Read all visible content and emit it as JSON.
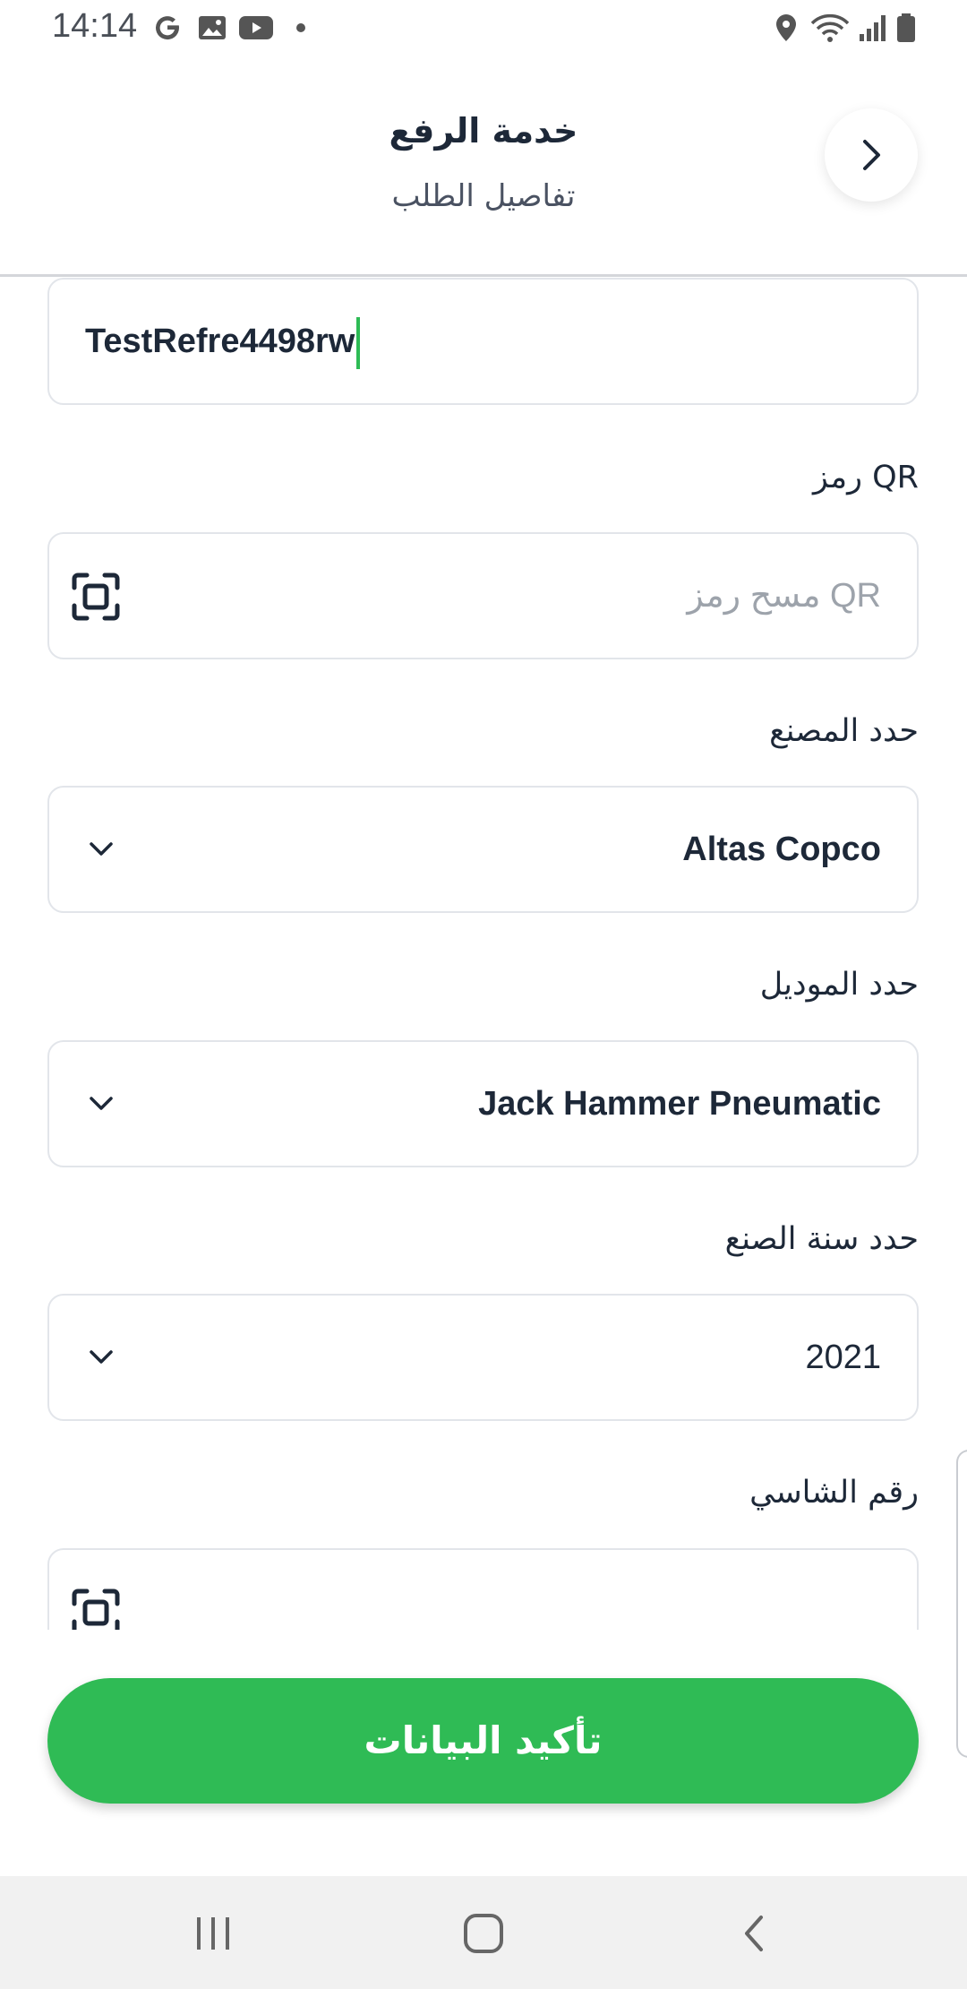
{
  "status_bar": {
    "time": "14:14",
    "icons": [
      "google-icon",
      "image-icon",
      "youtube-icon",
      "dot-icon",
      "location-icon",
      "wifi-icon",
      "signal-icon",
      "battery-icon"
    ]
  },
  "header": {
    "title": "خدمة الرفع",
    "subtitle": "تفاصيل الطلب",
    "back_icon": "chevron-right-icon"
  },
  "form": {
    "reference_field": {
      "value": "TestRefre4498rw"
    },
    "qr": {
      "label": "رمز QR",
      "placeholder": "مسح رمز QR",
      "icon": "qr-scan-icon"
    },
    "manufacturer": {
      "label": "حدد المصنع",
      "value": "Altas Copco",
      "icon": "chevron-down-icon"
    },
    "model": {
      "label": "حدد الموديل",
      "value": "Jack Hammer Pneumatic",
      "icon": "chevron-down-icon"
    },
    "year": {
      "label": "حدد سنة الصنع",
      "value": "2021",
      "icon": "chevron-down-icon"
    },
    "chassis": {
      "label": "رقم الشاسي",
      "icon": "qr-scan-icon"
    }
  },
  "confirm_button": {
    "label": "تأكيد البيانات",
    "color": "#2fbb55"
  },
  "nav_bar": {
    "icons": [
      "recents-icon",
      "home-icon",
      "back-icon"
    ]
  },
  "colors": {
    "accent": "#2fbb55",
    "text": "#1d2838",
    "border": "#e2e5ea"
  }
}
